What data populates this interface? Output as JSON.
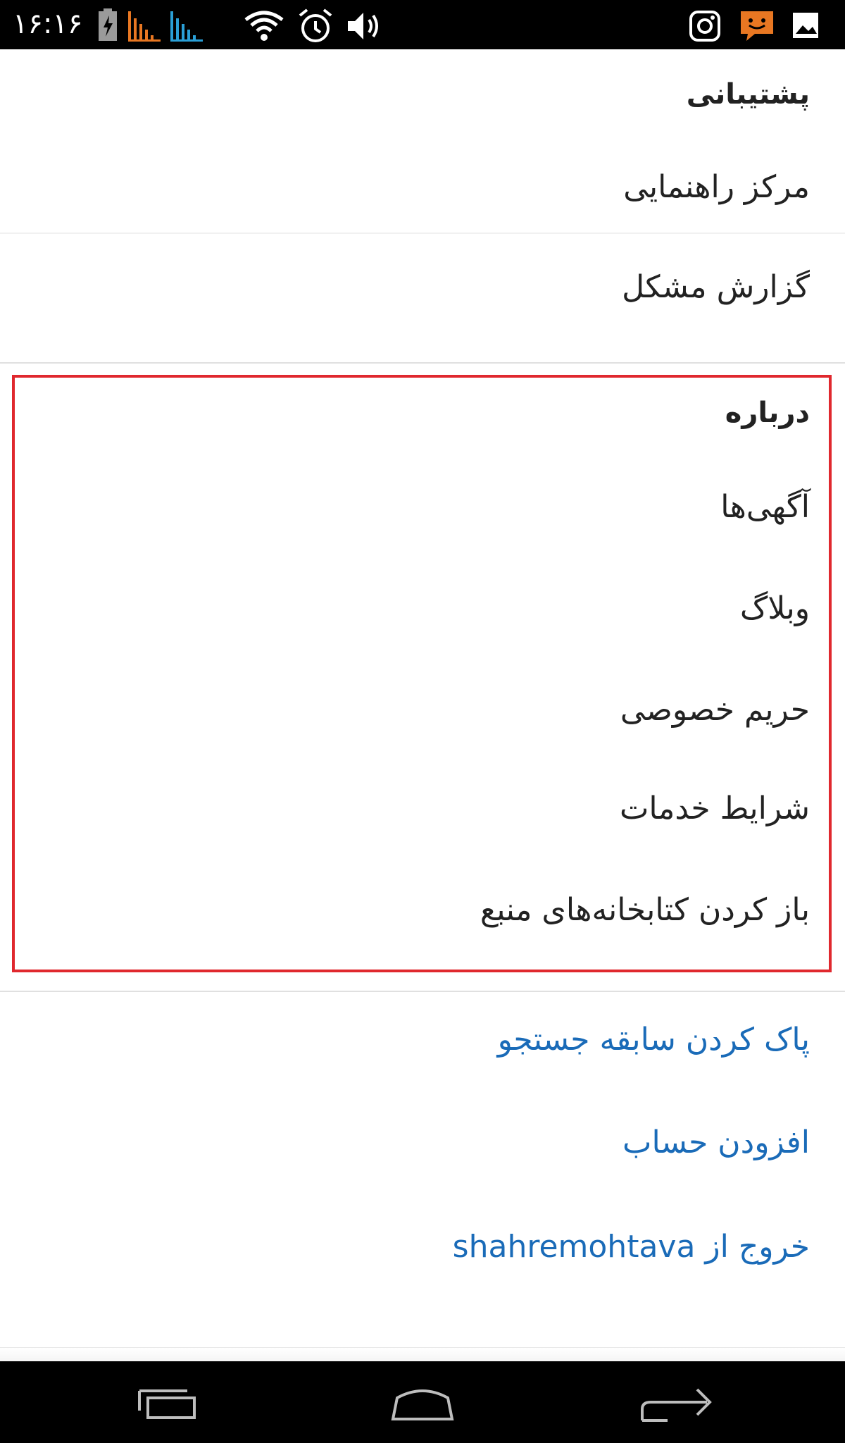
{
  "status_bar": {
    "time": "۱۶:۱۶",
    "icons": [
      "battery-charging-icon",
      "signal-orange-icon",
      "signal-blue-icon",
      "wifi-icon",
      "alarm-icon",
      "volume-icon",
      "instagram-icon",
      "chat-bubble-icon",
      "image-icon"
    ],
    "colors": {
      "background": "#000000",
      "signal_orange": "#e87722",
      "signal_blue": "#2a9fd6",
      "chat_orange": "#e87722"
    }
  },
  "support_section": {
    "header": "پشتیبانی",
    "items": [
      "مرکز راهنمایی",
      "گزارش مشکل"
    ]
  },
  "about_section": {
    "header": "درباره",
    "items": [
      "آگهی‌ها",
      "وبلاگ",
      "حریم خصوصی",
      "شرایط خدمات",
      "باز کردن کتابخانه‌های منبع"
    ],
    "highlight_color": "#e0282e"
  },
  "account_actions": {
    "items": [
      "پاک کردن سابقه جستجو",
      "افزودن حساب",
      "خروج از shahremohtava"
    ],
    "link_color": "#1a6bb8"
  },
  "nav_bar": {
    "buttons": [
      "recent-apps-icon",
      "home-icon",
      "back-icon"
    ]
  }
}
